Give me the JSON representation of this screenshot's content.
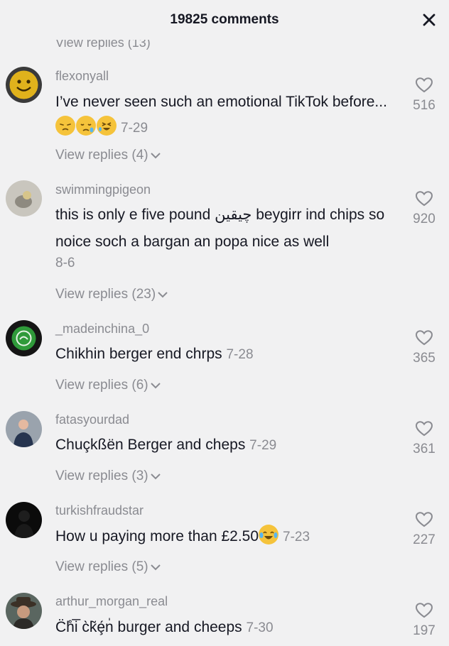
{
  "header": {
    "title": "19825 comments"
  },
  "partial_replies_label": "View replies (13)",
  "comments": [
    {
      "username": "flexonyall",
      "text": "I’ve never seen such an emotional TikTok before...",
      "date": "7-29",
      "likes": "516",
      "replies": "View replies (4)",
      "emojis": [
        "pensive-face-emoji",
        "sleepy-face-emoji",
        "rofl-emoji"
      ]
    },
    {
      "username": "swimmingpigeon",
      "text_a": "this is only e five pound",
      "arabic": "چیقین",
      "text_b": "beygirr ind chips so noice soch a bargan an popa nice as well",
      "date": "8-6",
      "likes": "920",
      "replies": "View replies (23)"
    },
    {
      "username": "_madeinchina_0",
      "text": "Chikhin berger end chrps",
      "date": "7-28",
      "likes": "365",
      "replies": "View replies (6)"
    },
    {
      "username": "fatasyourdad",
      "text": "Chuçkßën Berger and cheps",
      "date": "7-29",
      "likes": "361",
      "replies": "View replies (3)"
    },
    {
      "username": "turkishfraudstar",
      "text": "How u paying more than £2.50",
      "date": "7-23",
      "likes": "227",
      "replies": "View replies (5)",
      "emojis": [
        "tears-of-joy-emoji"
      ]
    },
    {
      "username": "arthur_morgan_real",
      "text": "C̈h̊i̅ c̀k̃ȩ́n̍ burger and cheeps",
      "date": "7-30",
      "likes": "197"
    }
  ]
}
